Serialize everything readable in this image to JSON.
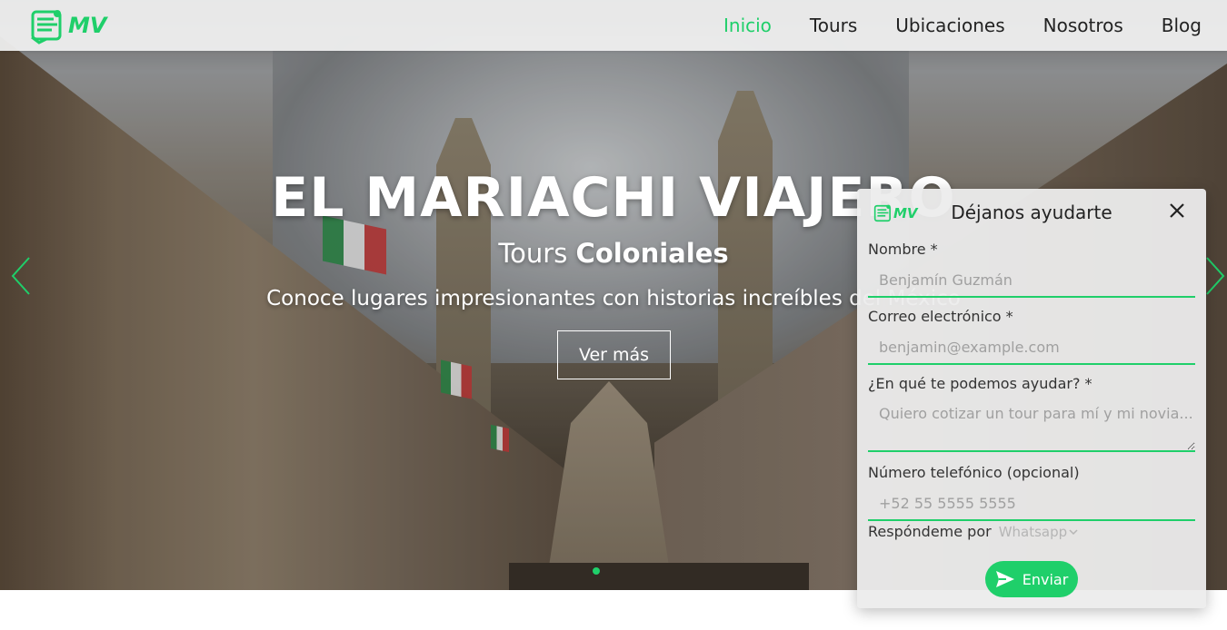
{
  "brand": {
    "logo_text": "MV",
    "accent_color": "#1fcf6a"
  },
  "nav": {
    "items": [
      {
        "label": "Inicio",
        "active": true
      },
      {
        "label": "Tours",
        "active": false
      },
      {
        "label": "Ubicaciones",
        "active": false
      },
      {
        "label": "Nosotros",
        "active": false
      },
      {
        "label": "Blog",
        "active": false
      }
    ]
  },
  "hero": {
    "title": "EL MARIACHI VIAJERO",
    "subtitle_prefix": "Tours",
    "subtitle_bold": "Coloniales",
    "description": "Conoce lugares impresionantes con historias increíbles del México",
    "button_label": "Ver más",
    "prev_icon": "chevron-left-icon",
    "next_icon": "chevron-right-icon",
    "slide_count": 1,
    "active_slide": 1
  },
  "below": {
    "heading": ""
  },
  "help_panel": {
    "title": "Déjanos ayudarte",
    "close_icon": "close-icon",
    "fields": {
      "name": {
        "label": "Nombre *",
        "placeholder": "Benjamín Guzmán"
      },
      "email": {
        "label": "Correo electrónico *",
        "placeholder": "benjamin@example.com"
      },
      "message": {
        "label": "¿En qué te podemos ayudar? *",
        "placeholder": "Quiero cotizar un tour para mí y mi novia..."
      },
      "phone": {
        "label": "Número telefónico (opcional)",
        "placeholder": "+52 55 5555 5555"
      }
    },
    "respond_label": "Respóndeme por",
    "respond_value": "Whatsapp",
    "send_label": "Enviar",
    "send_icon": "send-icon"
  }
}
